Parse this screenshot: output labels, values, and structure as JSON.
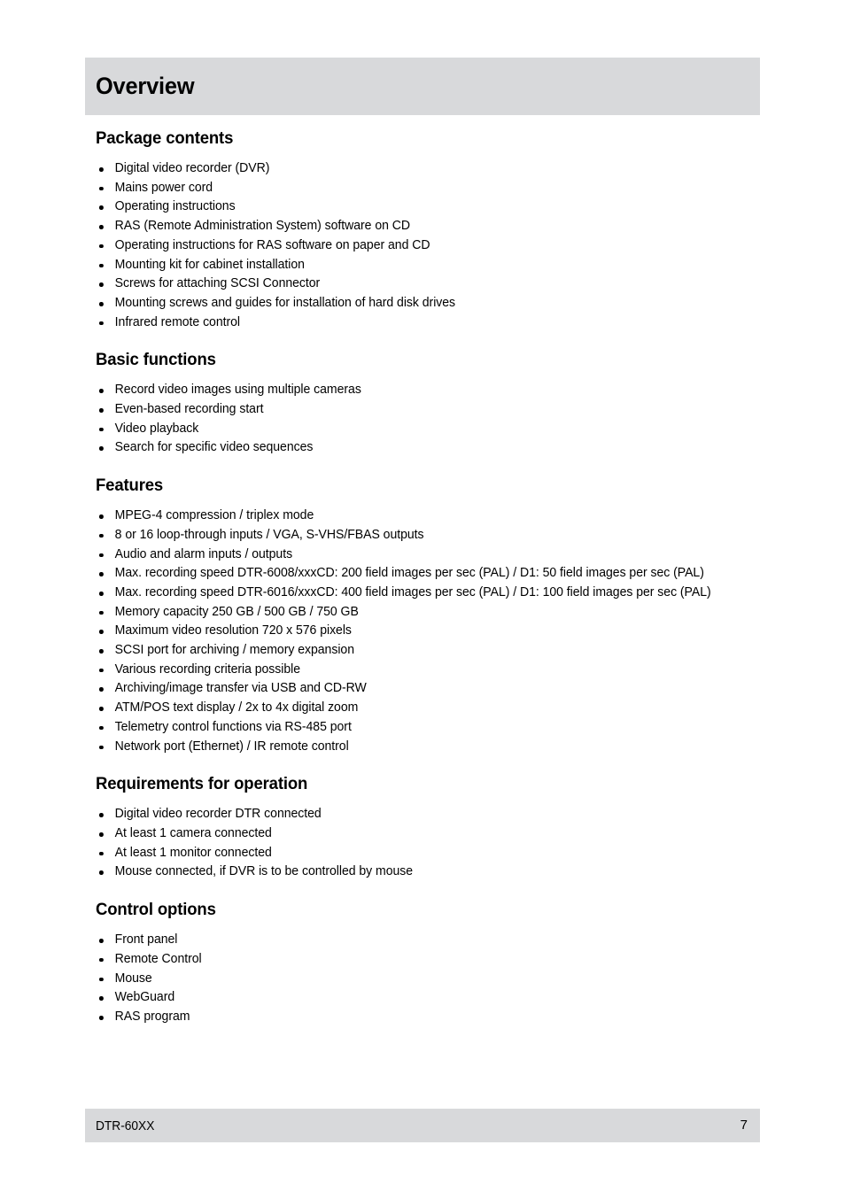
{
  "header": {
    "title": "Overview",
    "band_color": "#d8d9db"
  },
  "sections": [
    {
      "title": "Package contents",
      "items": [
        "Digital video recorder (DVR)",
        "Mains power cord",
        "Operating instructions",
        "RAS (Remote Administration System) software on CD",
        "Operating instructions for RAS software on paper and CD",
        "Mounting kit for cabinet installation",
        "Screws for attaching SCSI Connector",
        "Mounting screws and guides for installation of hard disk drives",
        "Infrared remote control"
      ]
    },
    {
      "title": "Basic functions",
      "items": [
        "Record video images using multiple cameras",
        "Even-based recording start",
        "Video playback",
        "Search for specific video sequences"
      ]
    },
    {
      "title": "Features",
      "items": [
        "MPEG-4 compression / triplex mode",
        "8 or 16 loop-through inputs / VGA, S-VHS/FBAS outputs",
        "Audio and alarm inputs / outputs",
        "Max. recording speed DTR-6008/xxxCD: 200 field images per sec (PAL) / D1: 50 field images per sec (PAL)",
        "Max. recording speed DTR-6016/xxxCD: 400 field images per sec (PAL) / D1: 100 field images per sec (PAL)",
        "Memory capacity 250 GB / 500 GB / 750 GB",
        "Maximum video resolution 720 x 576 pixels",
        "SCSI port for archiving / memory expansion",
        "Various recording criteria possible",
        "Archiving/image transfer via USB and CD-RW",
        "ATM/POS text display / 2x to 4x digital zoom",
        "Telemetry control functions via RS-485 port",
        "Network port (Ethernet) / IR remote control"
      ]
    },
    {
      "title": "Requirements for operation",
      "items": [
        "Digital video recorder DTR connected",
        "At least 1 camera connected",
        "At least 1 monitor connected",
        "Mouse connected, if DVR is to be controlled by mouse"
      ]
    },
    {
      "title": "Control options",
      "items": [
        "Front panel",
        "Remote Control",
        "Mouse",
        "WebGuard",
        "RAS program"
      ]
    }
  ],
  "footer": {
    "model": "DTR-60XX",
    "page_number": "7",
    "band_color": "#d8d9db"
  }
}
